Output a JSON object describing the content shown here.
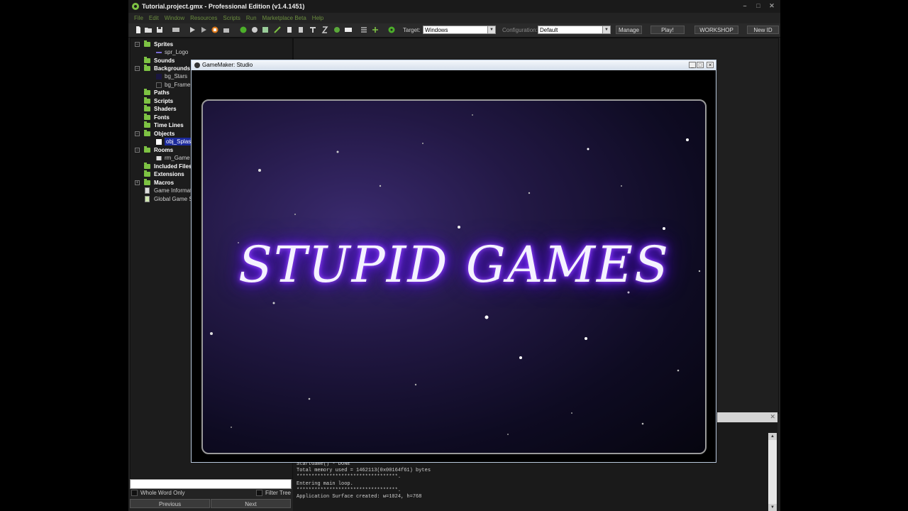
{
  "app": {
    "title": "Tutorial.project.gmx  -  Professional Edition (v1.4.1451)",
    "win_controls": [
      "–",
      "□",
      "✕"
    ]
  },
  "menu": [
    "File",
    "Edit",
    "Window",
    "Resources",
    "Scripts",
    "Run",
    "Marketplace Beta",
    "Help"
  ],
  "toolbar": {
    "target_label": "Target:",
    "target_value": "Windows",
    "config_label": "Configuration:",
    "config_value": "Default",
    "manage": "Manage",
    "play": "Play!",
    "workshop": "WORKSHOP",
    "new_id": "New ID"
  },
  "tree": {
    "sprites": "Sprites",
    "spr_logo": "spr_Logo",
    "sounds": "Sounds",
    "backgrounds": "Backgrounds",
    "bg_stars": "bg_Stars",
    "bg_frame": "bg_Frame",
    "paths": "Paths",
    "scripts": "Scripts",
    "shaders": "Shaders",
    "fonts": "Fonts",
    "timelines": "Time Lines",
    "objects": "Objects",
    "obj_splash": "obj_Splash",
    "rooms": "Rooms",
    "rm_game": "rm_Game",
    "included": "Included Files",
    "extensions": "Extensions",
    "macros": "Macros",
    "game_info": "Game Information",
    "global_settings": "Global Game Settings"
  },
  "search": {
    "whole_word": "Whole Word Only",
    "filter_tree": "Filter Tree",
    "previous": "Previous",
    "next": "Next"
  },
  "output": {
    "lines": [
      "StartGame() - DONE",
      "Total memory used = 1462113(0x00164f61) bytes",
      "**********************************.",
      "Entering main loop.",
      "**********************************.",
      "Application Surface created: w=1024, h=768"
    ]
  },
  "game_window": {
    "title": "GameMaker: Studio",
    "splash_text": "STUPID GAMES"
  },
  "colors": {
    "accent_green": "#7dc243",
    "selection_blue": "#1c2a9c",
    "glow_purple": "#7a2cff"
  }
}
